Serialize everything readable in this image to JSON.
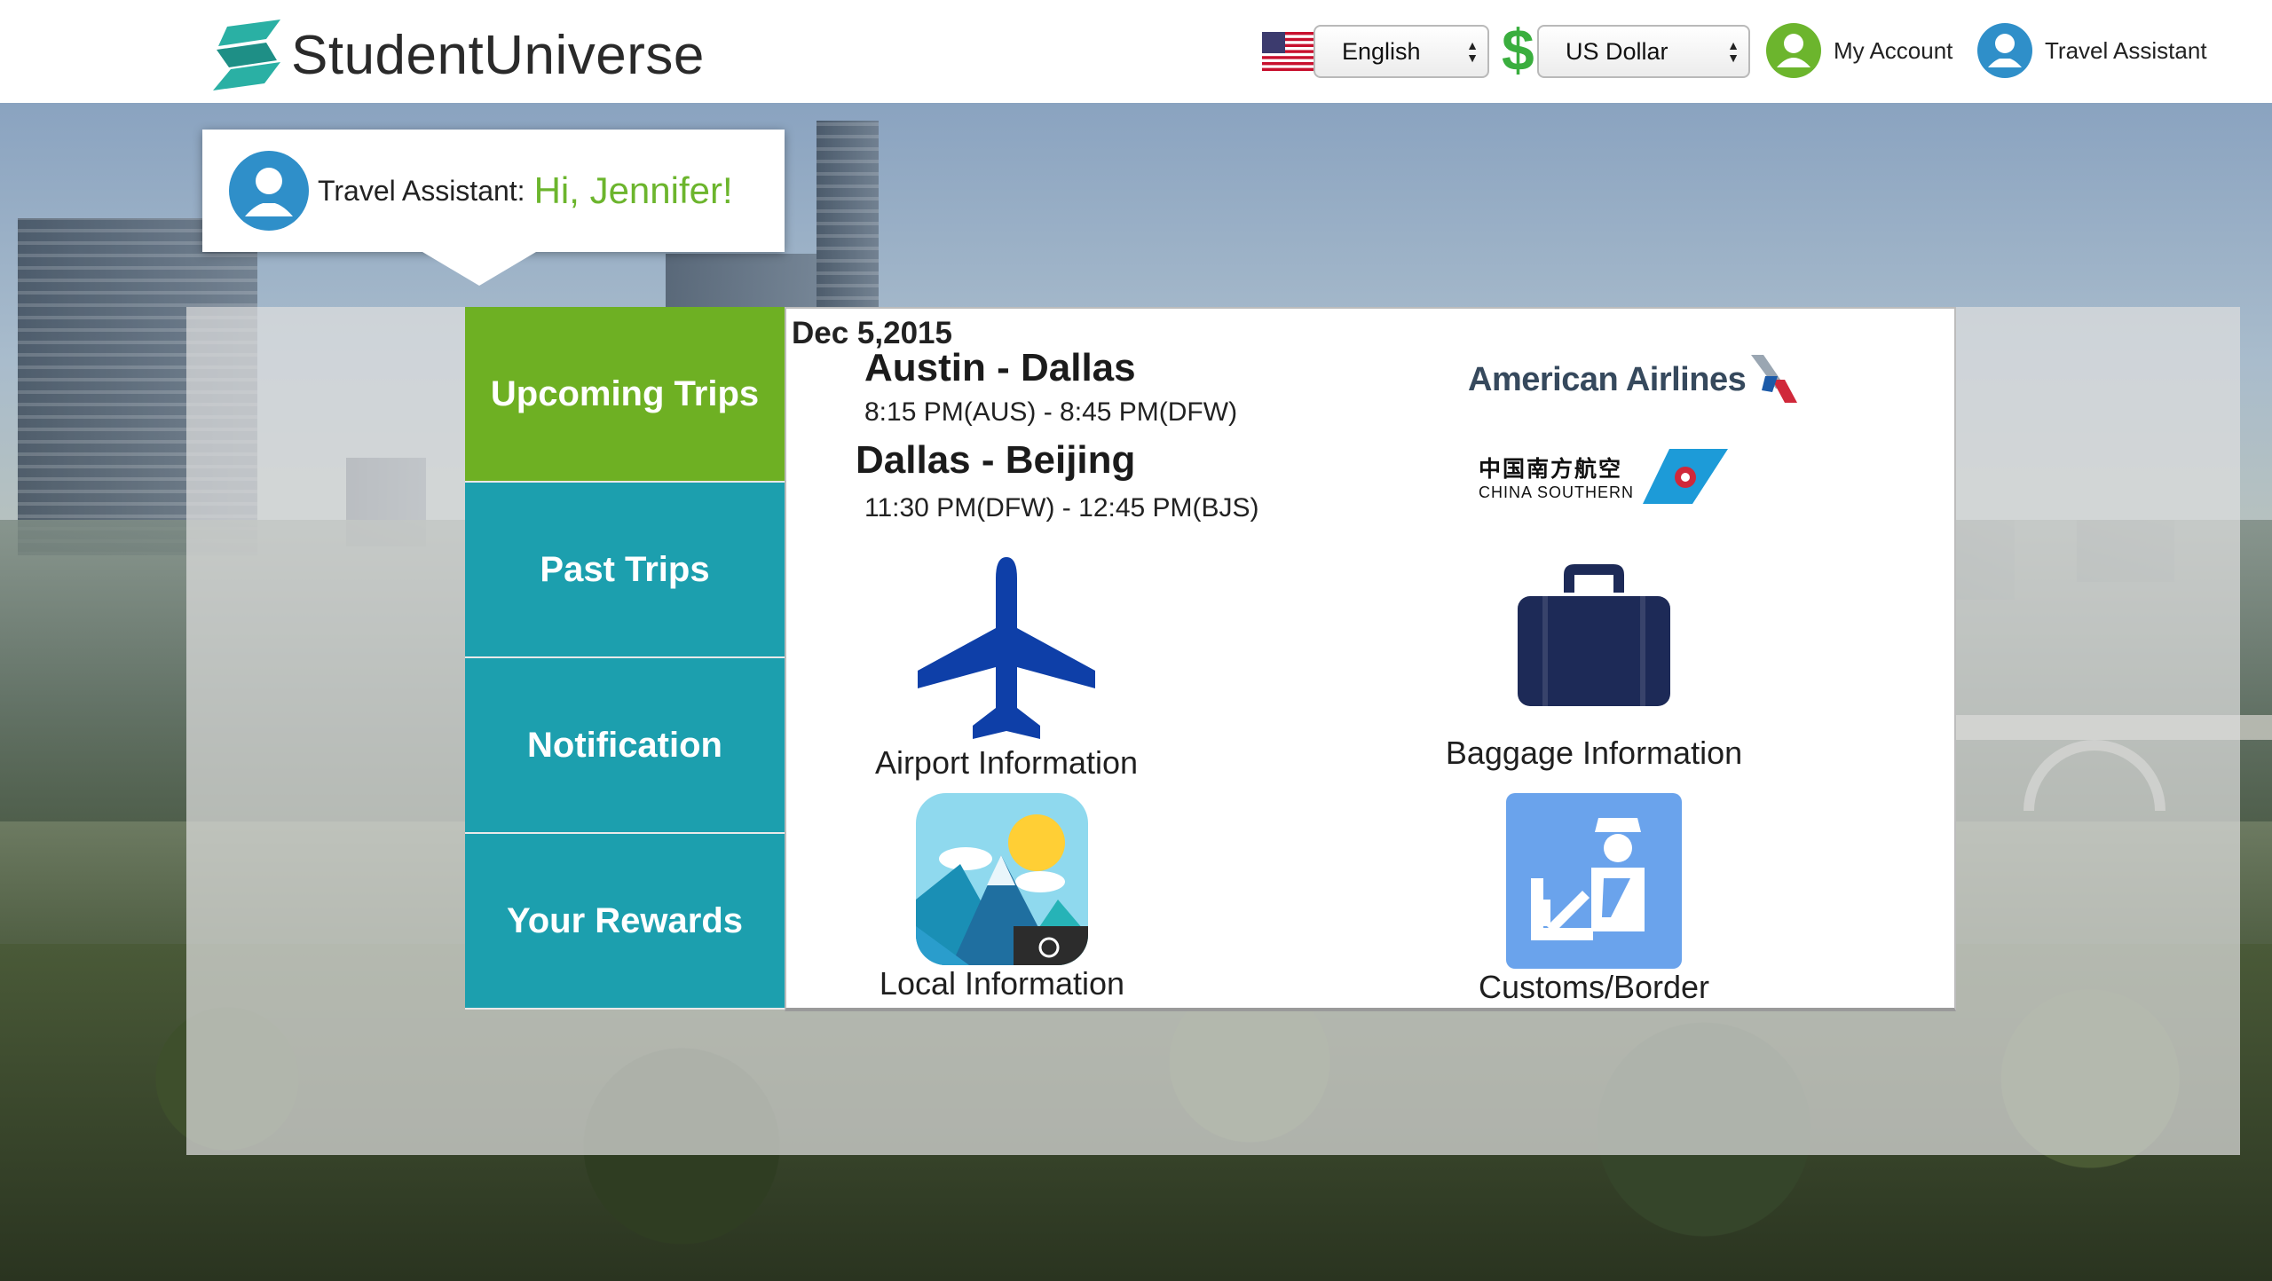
{
  "header": {
    "brand": "StudentUniverse",
    "language": {
      "selected": "English"
    },
    "currency": {
      "symbol": "$",
      "selected": "US Dollar"
    },
    "my_account": "My Account",
    "travel_assistant": "Travel Assistant"
  },
  "greeting": {
    "label": "Travel Assistant:",
    "message": "Hi, Jennifer!"
  },
  "tabs": [
    {
      "label": "Upcoming Trips",
      "active": true
    },
    {
      "label": "Past Trips",
      "active": false
    },
    {
      "label": "Notification",
      "active": false
    },
    {
      "label": "Your Rewards",
      "active": false
    }
  ],
  "trip": {
    "date": "Dec 5,2015",
    "legs": [
      {
        "route": "Austin - Dallas",
        "time": "8:15 PM(AUS) - 8:45 PM(DFW)",
        "airline": "American Airlines"
      },
      {
        "route": "Dallas - Beijing",
        "time": "11:30 PM(DFW) - 12:45 PM(BJS)",
        "airline_cn": "中国南方航空",
        "airline_en": "CHINA SOUTHERN"
      }
    ]
  },
  "tiles": {
    "airport": "Airport Information",
    "baggage": "Baggage Information",
    "local": "Local Information",
    "customs": "Customs/Border"
  },
  "colors": {
    "active_tab": "#6eb023",
    "tab": "#1c9fae",
    "greeting_accent": "#6cb52d",
    "plane_icon": "#0e3fa8",
    "baggage_icon": "#1d2a57",
    "customs_icon": "#6aa3ec"
  }
}
